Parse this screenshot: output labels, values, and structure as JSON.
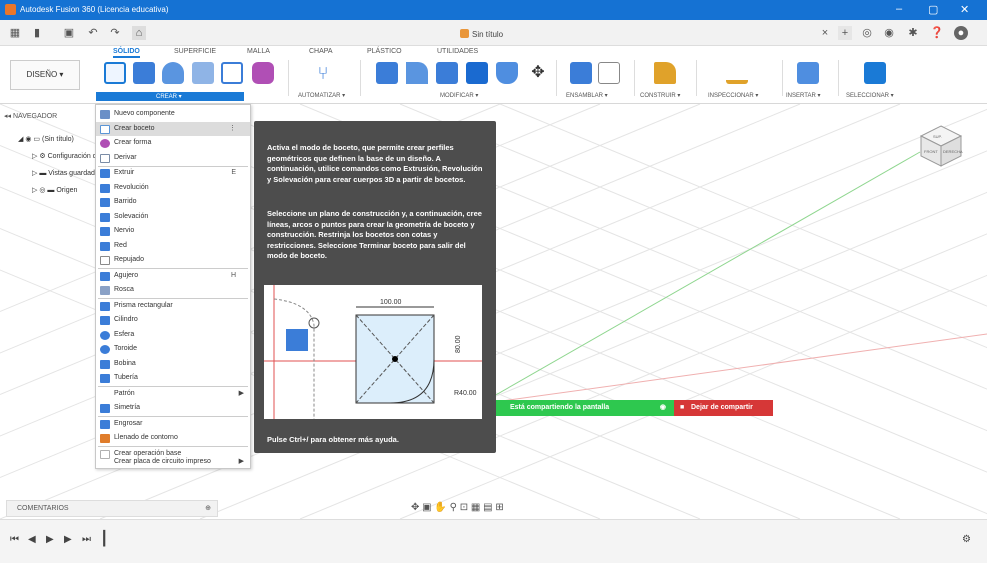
{
  "window": {
    "title": "Autodesk Fusion 360 (Licencia educativa)",
    "controls": {
      "minimize": "–",
      "restore": "▢",
      "close": "✕"
    }
  },
  "quickbar": {
    "document_title": "Sin título",
    "close_tab": "×",
    "new_tab": "+"
  },
  "ribbon": {
    "tabs": [
      "SÓLIDO",
      "SUPERFICIE",
      "MALLA",
      "CHAPA",
      "PLÁSTICO",
      "UTILIDADES"
    ],
    "workspace_button": "DISEÑO ▾",
    "groups": [
      "CREAR ▾",
      "AUTOMATIZAR ▾",
      "MODIFICAR ▾",
      "ENSAMBLAR ▾",
      "CONSTRUIR ▾",
      "INSPECCIONAR ▾",
      "INSERTAR ▾",
      "SELECCIONAR ▾"
    ]
  },
  "navigator": {
    "header": "NAVEGADOR",
    "rows": [
      "(Sin título)",
      "Configuración del documento",
      "Vistas guardadas",
      "Origen"
    ]
  },
  "create_menu": {
    "items": [
      {
        "label": "Nuevo componente",
        "shortcut": "",
        "icon": "component-icon",
        "color": "#6b8fc7"
      },
      {
        "label": "Crear boceto",
        "shortcut": "⋮",
        "icon": "sketch-icon",
        "color": "#5b95d6"
      },
      {
        "label": "Crear forma",
        "shortcut": "",
        "icon": "form-icon",
        "color": "#b04fb5"
      },
      {
        "label": "Derivar",
        "shortcut": "",
        "icon": "derive-icon",
        "color": "#7a8ca6"
      },
      {
        "label": "Extruir",
        "shortcut": "E",
        "icon": "extrude-icon",
        "color": "#3b7dd8"
      },
      {
        "label": "Revolución",
        "shortcut": "",
        "icon": "revolve-icon",
        "color": "#3b7dd8"
      },
      {
        "label": "Barrido",
        "shortcut": "",
        "icon": "sweep-icon",
        "color": "#3b7dd8"
      },
      {
        "label": "Solevación",
        "shortcut": "",
        "icon": "loft-icon",
        "color": "#3b7dd8"
      },
      {
        "label": "Nervio",
        "shortcut": "",
        "icon": "rib-icon",
        "color": "#3b7dd8"
      },
      {
        "label": "Red",
        "shortcut": "",
        "icon": "web-icon",
        "color": "#3b7dd8"
      },
      {
        "label": "Repujado",
        "shortcut": "",
        "icon": "emboss-icon",
        "color": "#8a8a8a"
      },
      {
        "label": "Agujero",
        "shortcut": "H",
        "icon": "hole-icon",
        "color": "#3b7dd8"
      },
      {
        "label": "Rosca",
        "shortcut": "",
        "icon": "thread-icon",
        "color": "#8aa1c6"
      },
      {
        "label": "Prisma rectangular",
        "shortcut": "",
        "icon": "box-icon",
        "color": "#3b7dd8"
      },
      {
        "label": "Cilindro",
        "shortcut": "",
        "icon": "cylinder-icon",
        "color": "#3b7dd8"
      },
      {
        "label": "Esfera",
        "shortcut": "",
        "icon": "sphere-icon",
        "color": "#3b7dd8"
      },
      {
        "label": "Toroide",
        "shortcut": "",
        "icon": "torus-icon",
        "color": "#3b7dd8"
      },
      {
        "label": "Bobina",
        "shortcut": "",
        "icon": "coil-icon",
        "color": "#3b7dd8"
      },
      {
        "label": "Tubería",
        "shortcut": "",
        "icon": "pipe-icon",
        "color": "#3b7dd8"
      },
      {
        "label": "Patrón",
        "shortcut": "",
        "icon": "",
        "color": "",
        "submenu": "▶"
      },
      {
        "label": "Simetría",
        "shortcut": "",
        "icon": "mirror-icon",
        "color": "#3b7dd8"
      },
      {
        "label": "Engrosar",
        "shortcut": "",
        "icon": "thicken-icon",
        "color": "#3b7dd8"
      },
      {
        "label": "Llenado de contorno",
        "shortcut": "",
        "icon": "boundary-fill-icon",
        "color": "#e07d2b"
      },
      {
        "label": "Crear operación base",
        "shortcut": "",
        "icon": "base-feature-icon",
        "color": "#b0b0b0"
      },
      {
        "label": "Crear placa de circuito impreso",
        "shortcut": "",
        "icon": "",
        "color": "",
        "submenu": "▶"
      }
    ]
  },
  "tooltip": {
    "paragraph1": "Activa el modo de boceto, que permite crear perfiles geométricos que definen la base de un diseño. A continuación, utilice comandos como Extrusión, Revolución y Solevación para crear cuerpos 3D a partir de bocetos.",
    "paragraph2": "Seleccione un plano de construcción y, a continuación, cree líneas, arcos o puntos para crear la geometría de boceto y construcción. Restrinja los bocetos con cotas y restricciones. Seleccione Terminar boceto para salir del modo de boceto.",
    "help_text": "Pulse Ctrl+/ para obtener más ayuda.",
    "illustration": {
      "dim_top": "100.00",
      "dim_side": "80.00",
      "dim_radius": "R40.00"
    }
  },
  "share_bar": {
    "sharing_text": "Está compartiendo la pantalla",
    "stop_button": "Dejar de compartir"
  },
  "viewcube": {
    "top_label": "SUP.",
    "front_label": "FRONT",
    "right_label": "DERECHA"
  },
  "bottom": {
    "comments_label": "COMENTARIOS",
    "timeline_buttons": [
      "⏮",
      "◀",
      "▶",
      "▶",
      "⏭"
    ]
  },
  "colors": {
    "titlebar": "#1572d3",
    "accent": "#1a7ad6",
    "tooltip_bg": "#4d4d4d",
    "share_green": "#2ec84f",
    "share_red": "#d63737"
  }
}
